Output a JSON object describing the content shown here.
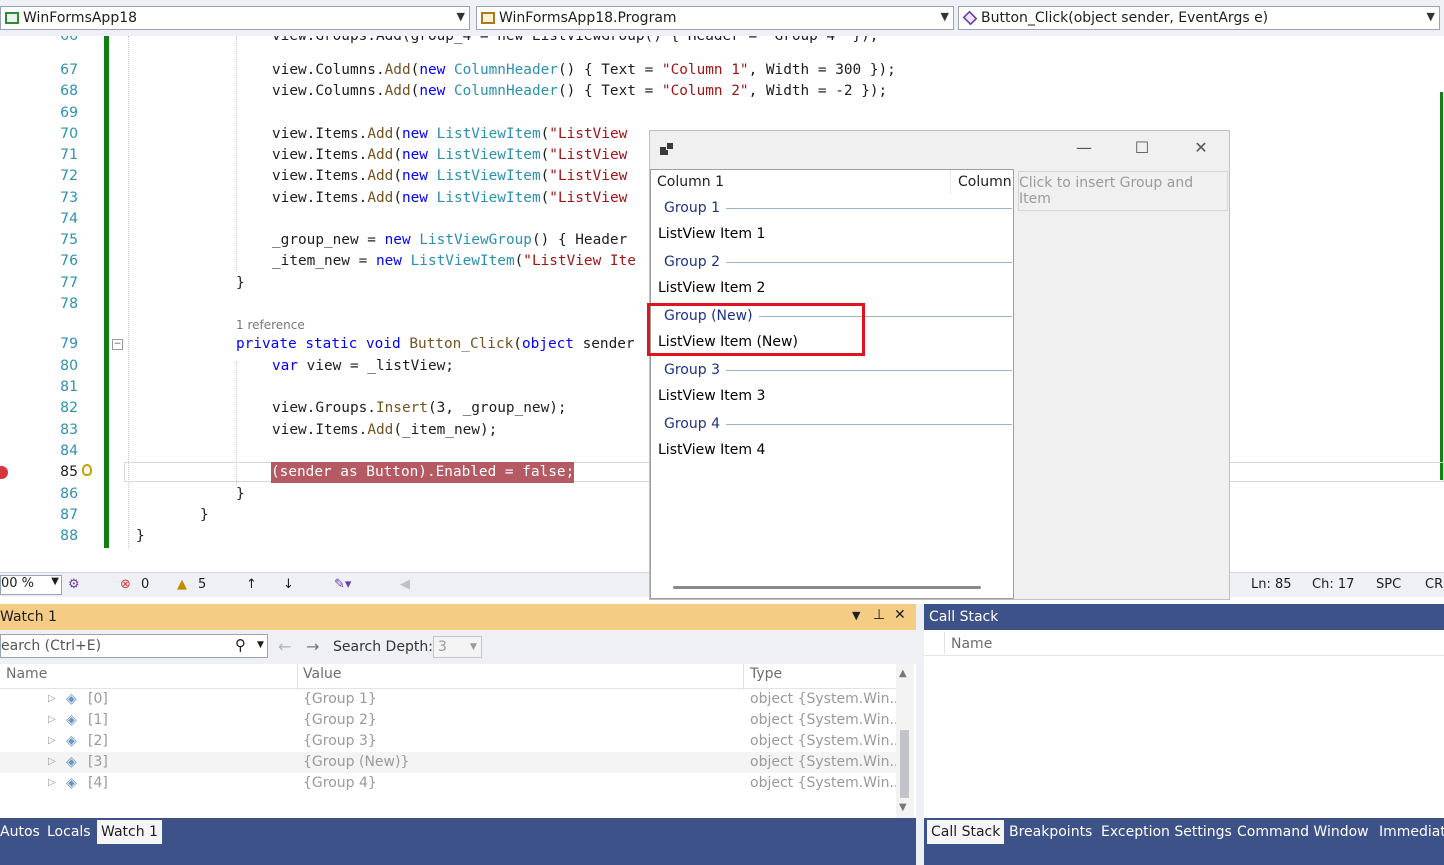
{
  "navbar": {
    "project": "WinFormsApp18",
    "class": "WinFormsApp18.Program",
    "method": "Button_Click(object sender, EventArgs e)"
  },
  "editor": {
    "reference_label": "1 reference",
    "lines": [
      {
        "n": "66",
        "code": "view.Groups.Add(group_4 = new ListViewGroup() { Header = \"Group 4\" });"
      },
      {
        "n": "67",
        "code": "view.Columns.Add(new ColumnHeader() { Text = \"Column 1\", Width = 300 });"
      },
      {
        "n": "68",
        "code": "view.Columns.Add(new ColumnHeader() { Text = \"Column 2\", Width = -2 });"
      },
      {
        "n": "69",
        "code": ""
      },
      {
        "n": "70",
        "code": "view.Items.Add(new ListViewItem(\"ListView"
      },
      {
        "n": "71",
        "code": "view.Items.Add(new ListViewItem(\"ListView"
      },
      {
        "n": "72",
        "code": "view.Items.Add(new ListViewItem(\"ListView"
      },
      {
        "n": "73",
        "code": "view.Items.Add(new ListViewItem(\"ListView"
      },
      {
        "n": "74",
        "code": ""
      },
      {
        "n": "75",
        "code": "_group_new = new ListViewGroup() { Header"
      },
      {
        "n": "76",
        "code": "_item_new = new ListViewItem(\"ListView Ite"
      },
      {
        "n": "77",
        "code": "}"
      },
      {
        "n": "78",
        "code": ""
      },
      {
        "n": "79",
        "code": "private static void Button_Click(object sender"
      },
      {
        "n": "80",
        "code": "var view = _listView;"
      },
      {
        "n": "81",
        "code": ""
      },
      {
        "n": "82",
        "code": "view.Groups.Insert(3, _group_new);"
      },
      {
        "n": "83",
        "code": "view.Items.Add(_item_new);"
      },
      {
        "n": "84",
        "code": ""
      },
      {
        "n": "85",
        "code": "(sender as Button).Enabled = false;"
      },
      {
        "n": "86",
        "code": "}"
      },
      {
        "n": "87",
        "code": "}"
      },
      {
        "n": "88",
        "code": "}"
      }
    ]
  },
  "status": {
    "zoom": "00 %",
    "errors": "0",
    "warnings": "5",
    "line": "Ln: 85",
    "col": "Ch: 17",
    "spc": "SPC",
    "crlf": "CRI"
  },
  "winform": {
    "listview": {
      "col1": "Column 1",
      "col2": "Column",
      "groups": [
        {
          "header": "Group 1",
          "item": "ListView Item 1"
        },
        {
          "header": "Group 2",
          "item": "ListView Item 2"
        },
        {
          "header": "Group (New)",
          "item": "ListView Item (New)"
        },
        {
          "header": "Group 3",
          "item": "ListView Item 3"
        },
        {
          "header": "Group 4",
          "item": "ListView Item 4"
        }
      ]
    },
    "button": "Click to insert Group and Item"
  },
  "watch": {
    "title": "Watch 1",
    "search_placeholder": "earch (Ctrl+E)",
    "search_depth_label": "Search Depth:",
    "search_depth_value": "3",
    "columns": [
      "Name",
      "Value",
      "Type"
    ],
    "rows": [
      {
        "name": "[0]",
        "value": "{Group 1}",
        "type": "object {System.Win..."
      },
      {
        "name": "[1]",
        "value": "{Group 2}",
        "type": "object {System.Win..."
      },
      {
        "name": "[2]",
        "value": "{Group 3}",
        "type": "object {System.Win..."
      },
      {
        "name": "[3]",
        "value": "{Group (New)}",
        "type": "object {System.Win..."
      },
      {
        "name": "[4]",
        "value": "{Group 4}",
        "type": "object {System.Win..."
      }
    ]
  },
  "callstack": {
    "title": "Call Stack",
    "column": "Name"
  },
  "tabs_left": [
    "Autos",
    "Locals",
    "Watch 1"
  ],
  "tabs_right": [
    "Call Stack",
    "Breakpoints",
    "Exception Settings",
    "Command Window",
    "Immediat"
  ],
  "colors": {
    "accent_tab": "#3d5288",
    "watch_title": "#f5cc84",
    "change_bar": "#108010",
    "highlight_box": "#e0141e"
  }
}
